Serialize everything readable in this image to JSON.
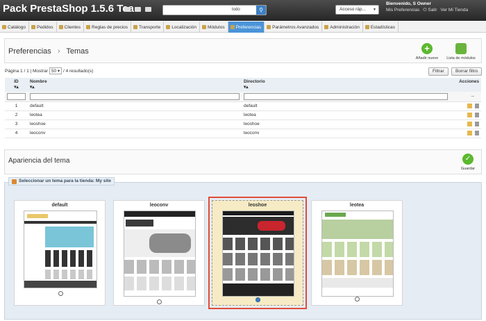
{
  "header": {
    "brand": "Pack PrestaShop 1.5.6 Tea",
    "search_value": "",
    "search_scope": "todo",
    "quick_access": "Acceso ráp...",
    "welcome": "Bienvenido, S Owner",
    "links": [
      "Mis Preferencias",
      "Salir",
      "Ver Mi Tienda"
    ]
  },
  "tabs": [
    "Catálogo",
    "Pedidos",
    "Clientes",
    "Reglas de precios",
    "Transporte",
    "Localización",
    "Módulos",
    "Preferencias",
    "Parámetros Avanzados",
    "Administración",
    "Estadísticas"
  ],
  "breadcrumb": {
    "parent": "Preferencias",
    "sep": "›",
    "current": "Temas"
  },
  "actions": {
    "add": "Añadir nuevo",
    "modules": "Lista de módulos"
  },
  "list": {
    "pagination": "Página 1 / 1 | Mostrar",
    "per_page": "50",
    "results": "/ 4 resultado(s)",
    "filter_btn": "Filtrar",
    "reset_btn": "Borrar filtro",
    "columns": {
      "id": "ID",
      "name": "Nombre",
      "dir": "Directorio",
      "actions": "Acciones"
    },
    "rows": [
      {
        "id": "1",
        "name": "default",
        "dir": "default"
      },
      {
        "id": "2",
        "name": "leotea",
        "dir": "leotea"
      },
      {
        "id": "3",
        "name": "leoshoe",
        "dir": "leoshoe"
      },
      {
        "id": "4",
        "name": "leoconv",
        "dir": "leoconv"
      }
    ],
    "filter_dash": "--"
  },
  "appearance": {
    "title": "Apariencia del tema",
    "save": "Guardar",
    "legend": "Seleccionar un tema para la tienda: My site",
    "themes": [
      {
        "name": "default"
      },
      {
        "name": "leoconv"
      },
      {
        "name": "leoshoe",
        "selected": true
      },
      {
        "name": "leotea"
      }
    ]
  },
  "colors": {
    "accent": "#4b94d8",
    "selected_outline": "#e04d37",
    "add_green": "#5cb82f"
  }
}
